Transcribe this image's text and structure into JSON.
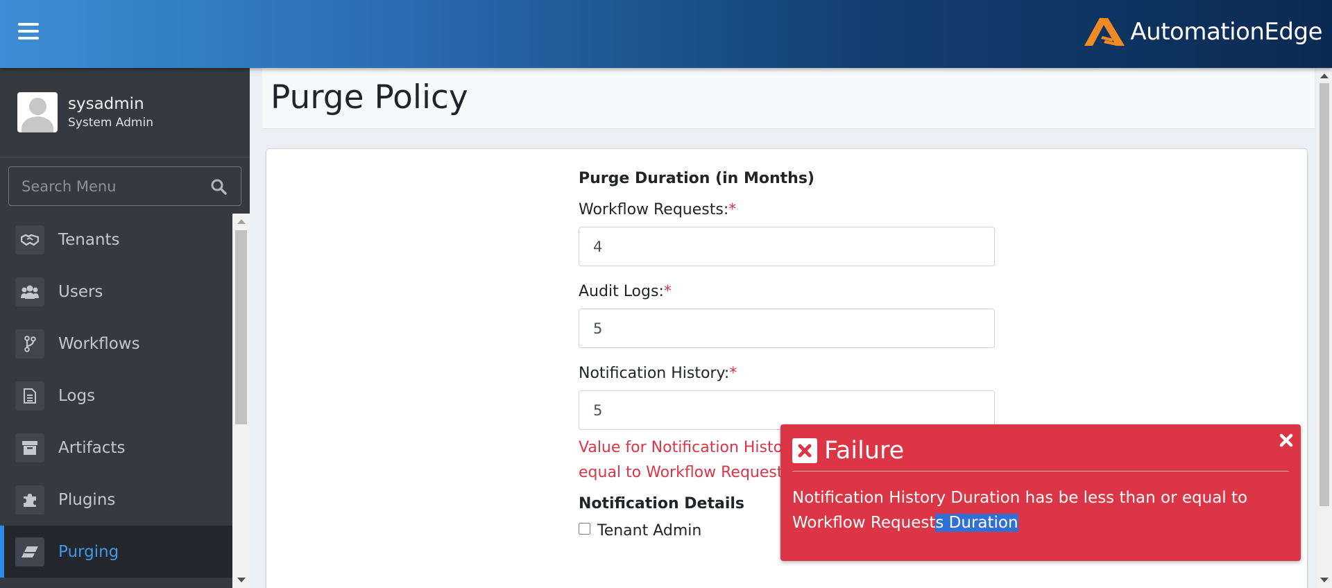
{
  "header": {
    "menu_icon": "hamburger-icon",
    "logo_text": "AutomationEdge",
    "logo_colors": {
      "accent": "#f08a24"
    }
  },
  "sidebar": {
    "user": {
      "name": "sysadmin",
      "role": "System Admin"
    },
    "search": {
      "placeholder": "Search Menu"
    },
    "items": [
      {
        "label": "Tenants",
        "icon": "handshake-icon"
      },
      {
        "label": "Users",
        "icon": "users-icon"
      },
      {
        "label": "Workflows",
        "icon": "branch-icon"
      },
      {
        "label": "Logs",
        "icon": "document-icon"
      },
      {
        "label": "Artifacts",
        "icon": "archive-icon"
      },
      {
        "label": "Plugins",
        "icon": "puzzle-icon"
      },
      {
        "label": "Purging",
        "icon": "eraser-icon",
        "active": true
      }
    ]
  },
  "page": {
    "title": "Purge Policy"
  },
  "form": {
    "section_title": "Purge Duration (in Months)",
    "workflow_requests": {
      "label": "Workflow Requests:",
      "required": "*",
      "value": "4"
    },
    "audit_logs": {
      "label": "Audit Logs:",
      "required": "*",
      "value": "5"
    },
    "notification_history": {
      "label": "Notification History:",
      "required": "*",
      "value": "5"
    },
    "error_message": "Value for Notification History should be less than or equal to Workflow Request.",
    "notification_details_title": "Notification Details",
    "tenant_admin_label": "Tenant Admin",
    "tenant_admin_checked": false
  },
  "toast": {
    "title": "Failure",
    "message_plain": "Notification History Duration has be less than or equal to Workflow Request",
    "message_selected": "s Duration",
    "color": "#dc3545"
  }
}
